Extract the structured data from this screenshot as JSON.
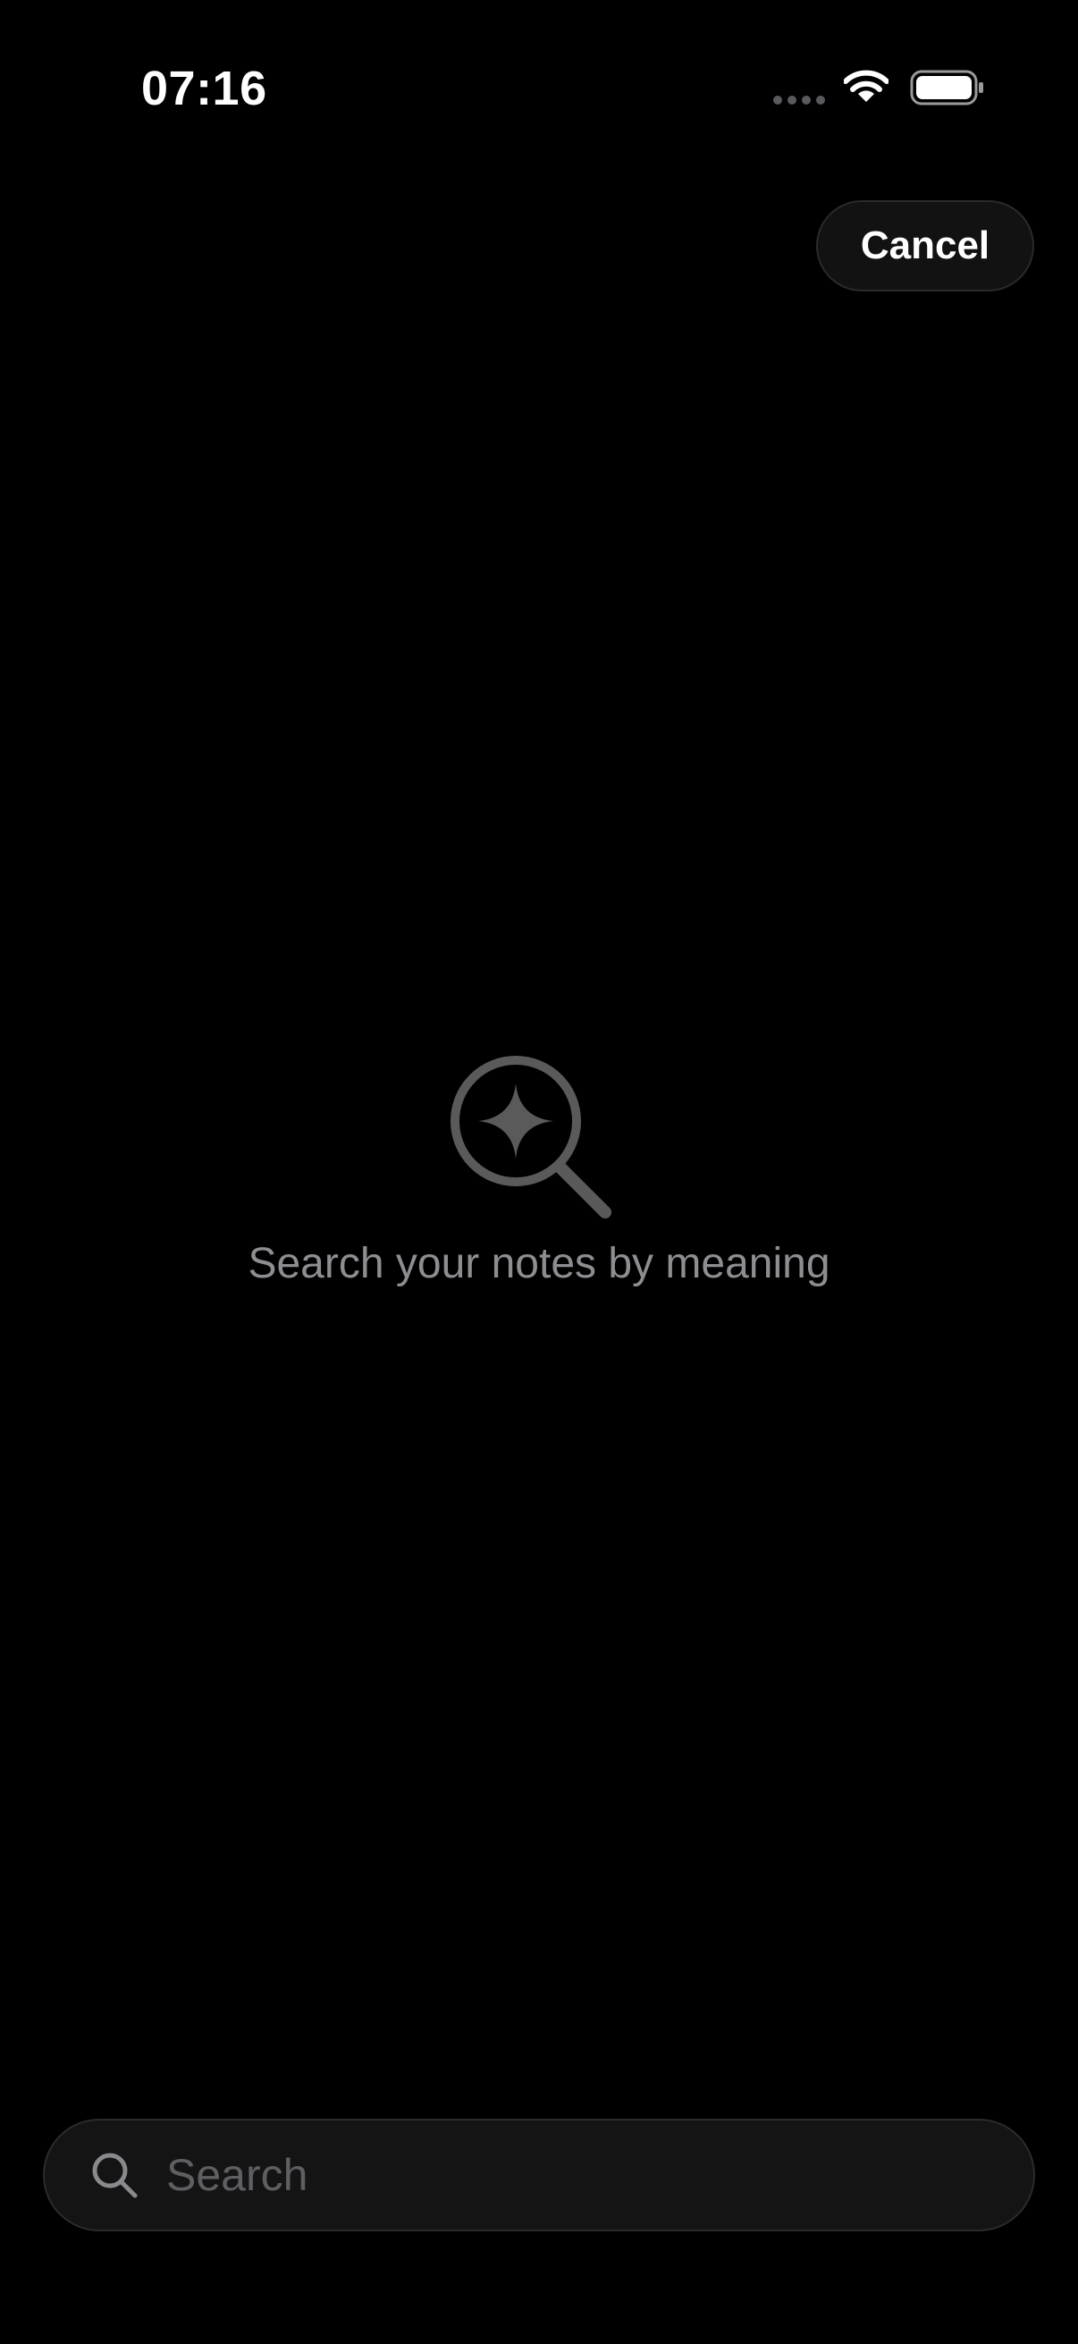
{
  "status_bar": {
    "time": "07:16",
    "icons": [
      "signal-dots-icon",
      "wifi-icon",
      "battery-icon"
    ]
  },
  "header": {
    "cancel_label": "Cancel"
  },
  "empty_state": {
    "icon": "sparkle-search-icon",
    "message": "Search your notes by meaning"
  },
  "search": {
    "placeholder": "Search",
    "value": "",
    "icon": "search-icon"
  },
  "colors": {
    "background": "#000000",
    "muted_text": "#8e8e92",
    "icon_gray": "#5a5a5a",
    "button_bg": "#121212",
    "search_bg": "#141414",
    "placeholder": "#5f5f63"
  }
}
